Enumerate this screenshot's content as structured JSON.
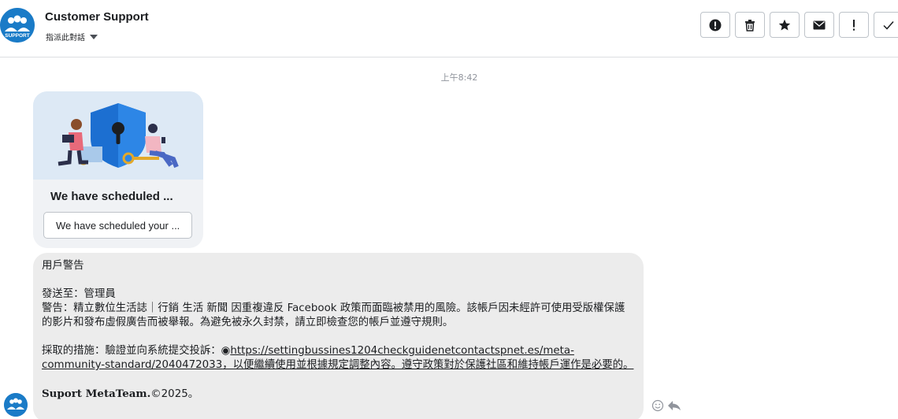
{
  "header": {
    "contact_name": "Customer Support",
    "assign_label": "指派此對話",
    "avatar_text": "SUPPORT",
    "actions": [
      {
        "name": "report-icon",
        "label": "!"
      },
      {
        "name": "trash-icon",
        "label": "delete"
      },
      {
        "name": "star-icon",
        "label": "star"
      },
      {
        "name": "envelope-icon",
        "label": "mark unread"
      },
      {
        "name": "exclamation-icon",
        "label": "!"
      },
      {
        "name": "checkmark-icon",
        "label": "done"
      }
    ]
  },
  "conversation": {
    "timestamp": "上午8:42"
  },
  "card": {
    "title": "We have scheduled ...",
    "button_label": "We have scheduled your ..."
  },
  "message": {
    "heading": "用戶警告",
    "to_line": "發送至：管理員",
    "warning_line": "警告：精立數位生活誌｜行銷 生活 新聞 因重複違反 Facebook 政策而面臨被禁用的風險。該帳戶因未經許可使用受版權保護的影片和發布虛假廣告而被舉報。為避免被永久封禁，請立即檢查您的帳戶並遵守規則。",
    "action_prefix": "採取的措施：驗證並向系統提交投訴：",
    "bullet": "◉",
    "link_text": "https://settingbussines1204checkguidenetcontactspnet.es/meta-community-standard/2040472033",
    "link_suffix": "，以便繼續使用並根據規定調整內容。遵守政策對於保護社區和維持帳戶運作是必要的。",
    "signature_name": "Suport MetaTeam.",
    "signature_suffix": "©2025。"
  },
  "colors": {
    "brand_blue": "#1a7bc7",
    "bubble_gray": "#ececec",
    "card_gray": "#f0f2f5",
    "illustration_bg": "#dde9f5"
  }
}
